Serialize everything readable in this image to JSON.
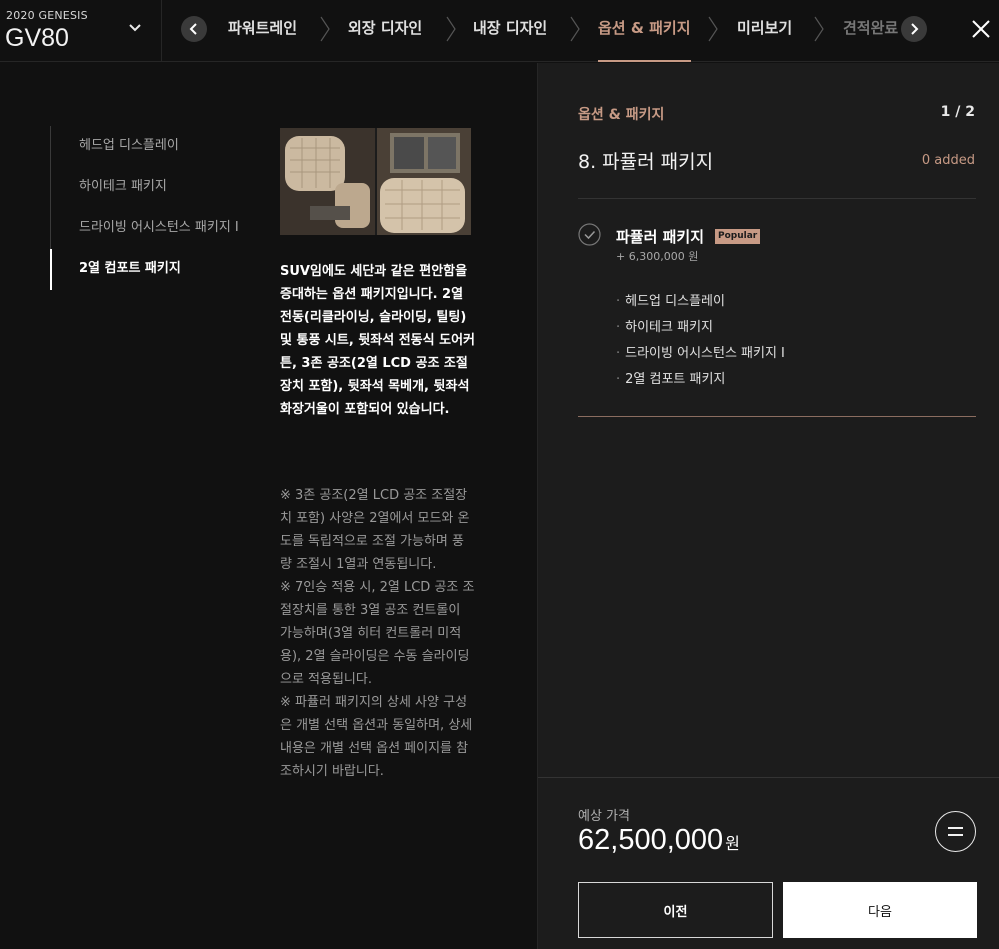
{
  "header": {
    "model_year": "2020 GENESIS",
    "model_name": "GV80",
    "steps": [
      {
        "label": "파워트레인",
        "state": "normal"
      },
      {
        "label": "외장 디자인",
        "state": "normal"
      },
      {
        "label": "내장 디자인",
        "state": "normal"
      },
      {
        "label": "옵션 & 패키지",
        "state": "active"
      },
      {
        "label": "미리보기",
        "state": "normal"
      },
      {
        "label": "견적완료",
        "state": "faded"
      }
    ]
  },
  "sidebar": {
    "items": [
      {
        "label": "헤드업 디스플레이"
      },
      {
        "label": "하이테크 패키지"
      },
      {
        "label": "드라이빙 어시스턴스 패키지 Ⅰ"
      },
      {
        "label": "2열 컴포트 패키지"
      }
    ]
  },
  "detail": {
    "description": "SUV임에도 세단과 같은 편안함을 증대하는 옵션 패키지입니다. 2열 전동(리클라이닝, 슬라이딩, 틸팅) 및 통풍 시트, 뒷좌석 전동식 도어커튼, 3존 공조(2열 LCD 공조 조절장치 포함), 뒷좌석 목베개, 뒷좌석 화장거울이 포함되어 있습니다.",
    "notes": [
      "※ 3존 공조(2열 LCD 공조 조절장치 포함) 사양은 2열에서 모드와 온도를 독립적으로 조절 가능하며 풍량 조절시 1열과 연동됩니다.",
      "※ 7인승 적용 시, 2열 LCD 공조 조절장치를 통한 3열 공조 컨트롤이 가능하며(3열 히터 컨트롤러 미적용), 2열 슬라이딩은 수동 슬라이딩으로 적용됩니다.",
      "※ 파퓰러 패키지의 상세 사양 구성은 개별 선택 옵션과 동일하며, 상세 내용은 개별 선택 옵션 페이지를 참조하시기 바랍니다."
    ]
  },
  "panel": {
    "category": "옵션 & 패키지",
    "page": "1 / 2",
    "title": "8. 파퓰러 패키지",
    "added": "0 added",
    "package": {
      "name": "파퓰러 패키지",
      "badge": "Popular",
      "price": "+ 6,300,000 원",
      "items": [
        "헤드업 디스플레이",
        "하이테크 패키지",
        "드라이빙 어시스턴스 패키지 Ⅰ",
        "2열 컴포트 패키지"
      ]
    }
  },
  "footer": {
    "price_label": "예상 가격",
    "price_value": "62,500,000",
    "price_unit": "원",
    "prev_label": "이전",
    "next_label": "다음"
  },
  "colors": {
    "accent": "#c79a85",
    "background": "#111111",
    "panel": "#1c1c1c"
  }
}
